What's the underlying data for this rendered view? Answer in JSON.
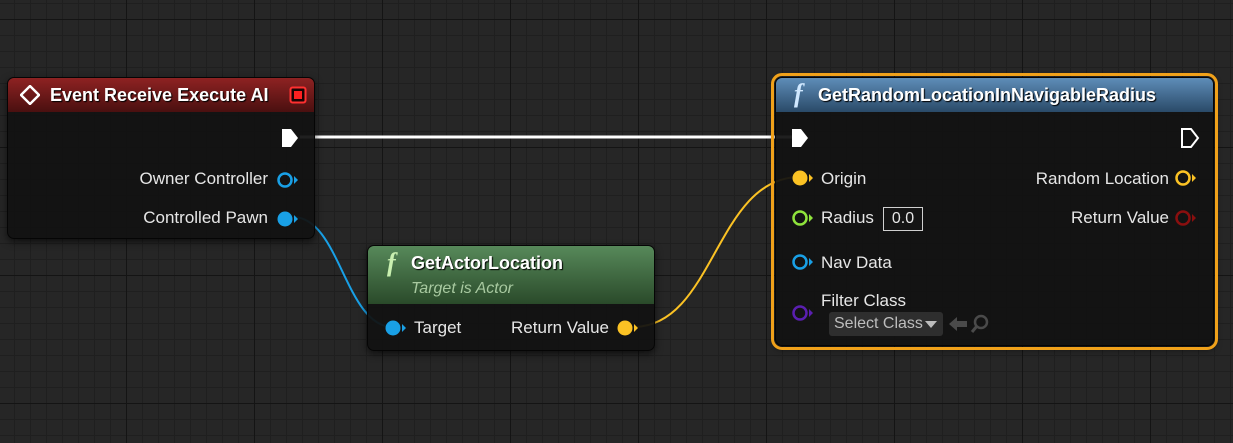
{
  "nodes": {
    "event": {
      "title": "Event Receive Execute AI",
      "pins": {
        "owner": "Owner Controller",
        "pawn": "Controlled Pawn"
      }
    },
    "get_actor_location": {
      "title": "GetActorLocation",
      "subtitle": "Target is Actor",
      "pins": {
        "target": "Target",
        "return": "Return Value"
      }
    },
    "get_random_location": {
      "title": "GetRandomLocationInNavigableRadius",
      "pins": {
        "origin": "Origin",
        "radius": "Radius",
        "radius_value": "0.0",
        "nav_data": "Nav Data",
        "filter_class": "Filter Class",
        "filter_select": "Select Class",
        "random_location": "Random Location",
        "return": "Return Value"
      }
    }
  },
  "colors": {
    "event_header": "#7a1b1b",
    "function_header_blue": "#4d7aa3",
    "function_header_green": "#4d7a4a",
    "object_pin": "#19a0e6",
    "vector_pin": "#fbc224",
    "float_pin": "#8fe33c",
    "bool_pin": "#8a0f0f",
    "class_pin": "#5a1fb0",
    "selection": "#f0a11a"
  },
  "icons": [
    "event-diamond-icon",
    "delegate-square-icon",
    "function-icon",
    "exec-pin-icon",
    "browse-arrow-icon",
    "search-icon",
    "dropdown-arrow-icon"
  ]
}
